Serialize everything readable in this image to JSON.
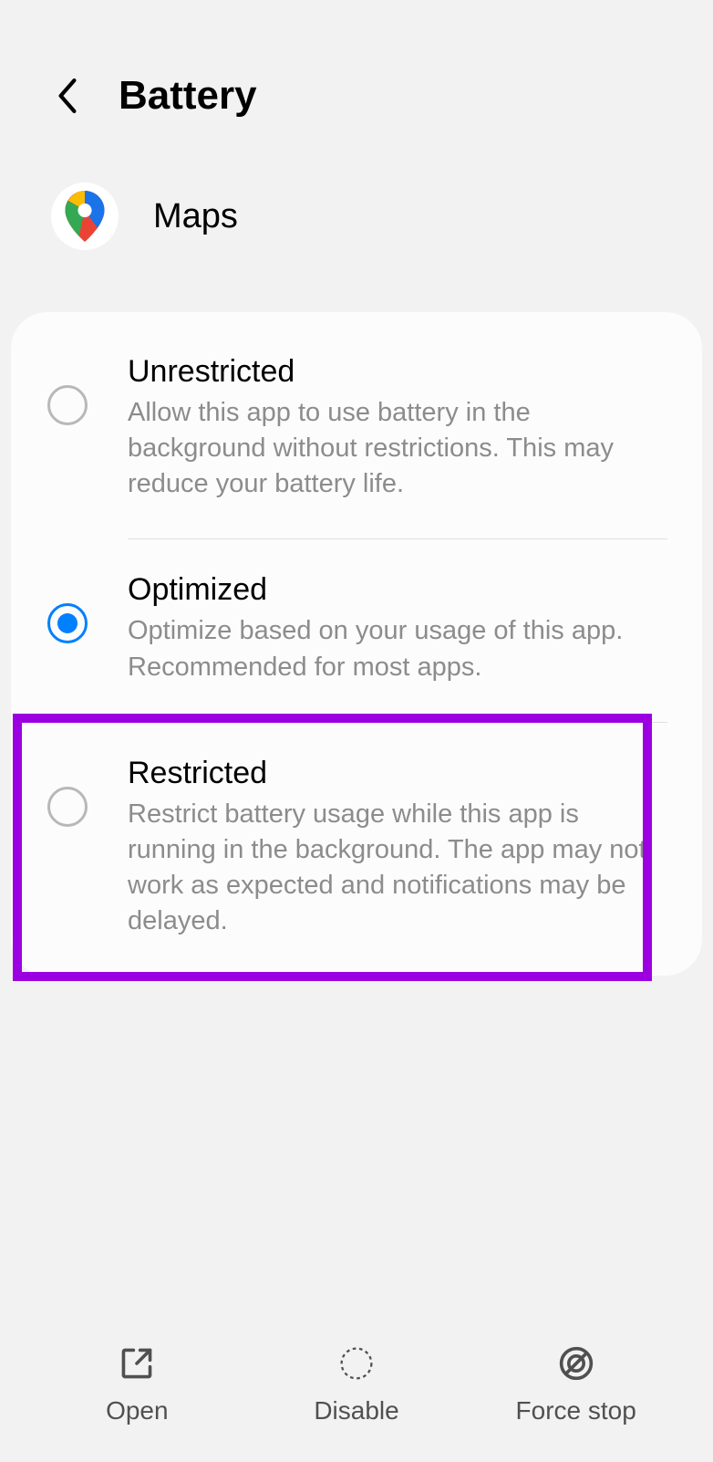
{
  "header": {
    "title": "Battery"
  },
  "app": {
    "name": "Maps"
  },
  "options": {
    "unrestricted": {
      "title": "Unrestricted",
      "description": "Allow this app to use battery in the background without restrictions. This may reduce your battery life.",
      "selected": false
    },
    "optimized": {
      "title": "Optimized",
      "description": "Optimize based on your usage of this app. Recommended for most apps.",
      "selected": true
    },
    "restricted": {
      "title": "Restricted",
      "description": "Restrict battery usage while this app is running in the background. The app may not work as expected and notifications may be delayed.",
      "selected": false
    }
  },
  "bottom_nav": {
    "open": "Open",
    "disable": "Disable",
    "force_stop": "Force stop"
  }
}
